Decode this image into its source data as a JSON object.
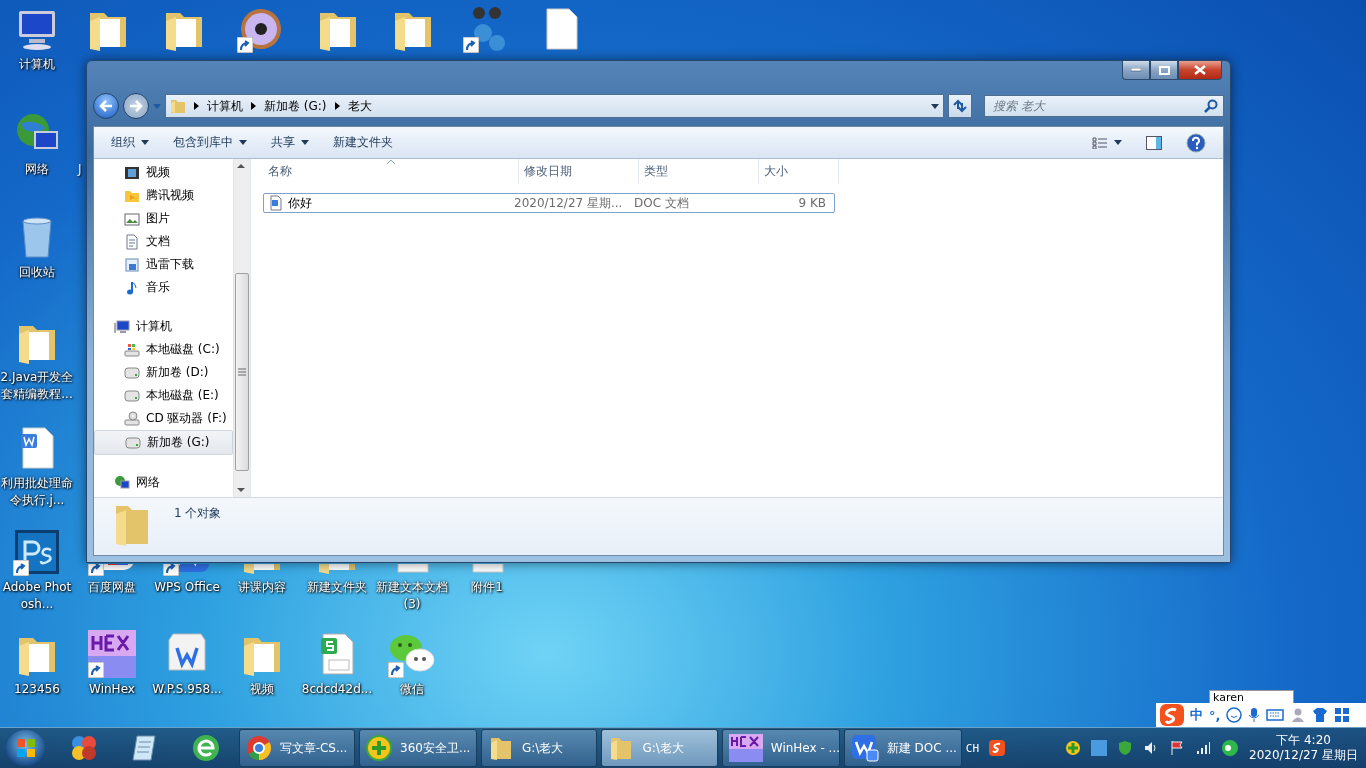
{
  "desktop": {
    "icons": [
      {
        "kind": "computer",
        "label": "计算机",
        "shortcut": false
      },
      {
        "kind": "folder",
        "shortcut": false
      },
      {
        "kind": "folder",
        "shortcut": false
      },
      {
        "kind": "disc",
        "shortcut": true
      },
      {
        "kind": "folder",
        "shortcut": false
      },
      {
        "kind": "folder",
        "shortcut": false
      },
      {
        "kind": "molecule",
        "shortcut": true
      },
      {
        "kind": "blank",
        "shortcut": false
      },
      {
        "kind": "globe",
        "label": "网络",
        "shortcut": false
      },
      {
        "kind": "bin",
        "label": "回收站",
        "shortcut": false
      },
      {
        "kind": "folder",
        "label": "2.Java开发全套精编教程...",
        "shortcut": false
      },
      {
        "kind": "worddoc",
        "label": "利用批处理命令执行.j...",
        "shortcut": false
      },
      {
        "kind": "ps",
        "label": "Adobe Photosh...",
        "shortcut": true
      },
      {
        "kind": "folder",
        "label": "123456",
        "shortcut": false
      },
      {
        "kind": "baidu",
        "label": "百度网盘",
        "shortcut": true
      },
      {
        "kind": "wps",
        "label": "WPS Office",
        "shortcut": true
      },
      {
        "kind": "folder",
        "label": "讲课内容",
        "shortcut": false
      },
      {
        "kind": "folder",
        "label": "新建文件夹",
        "shortcut": false
      },
      {
        "kind": "blank",
        "label": "新建文本文档 (3)",
        "shortcut": false
      },
      {
        "kind": "blank",
        "label": "附件1",
        "shortcut": false
      },
      {
        "kind": "hex",
        "label": "WinHex",
        "shortcut": true
      },
      {
        "kind": "wpsbox",
        "label": "W.P.S.958...",
        "shortcut": false
      },
      {
        "kind": "folder",
        "label": "视频",
        "shortcut": false
      },
      {
        "kind": "sheet",
        "label": "8cdcd42d...",
        "shortcut": false
      },
      {
        "kind": "wechat",
        "label": "微信",
        "shortcut": true
      }
    ],
    "fragment": "J"
  },
  "window": {
    "address": [
      "计算机",
      "新加卷 (G:)",
      "老大"
    ],
    "search": {
      "placeholder": "搜索 老大"
    },
    "toolbar": [
      {
        "label": "组织",
        "menu": true
      },
      {
        "label": "包含到库中",
        "menu": true
      },
      {
        "label": "共享",
        "menu": true
      },
      {
        "label": "新建文件夹",
        "menu": false
      }
    ],
    "nav": [
      {
        "kind": "video",
        "label": "视频",
        "selected": false
      },
      {
        "kind": "tencent",
        "label": "腾讯视频",
        "selected": false
      },
      {
        "kind": "pictures",
        "label": "图片",
        "selected": false
      },
      {
        "kind": "docs",
        "label": "文档",
        "selected": false
      },
      {
        "kind": "download",
        "label": "迅雷下载",
        "selected": false
      },
      {
        "kind": "music",
        "label": "音乐",
        "selected": false
      },
      {
        "kind": "computer",
        "label": "计算机",
        "selected": false,
        "children": [
          {
            "kind": "winDrive",
            "label": "本地磁盘 (C:)",
            "selected": false
          },
          {
            "kind": "drive",
            "label": "新加卷 (D:)",
            "selected": false
          },
          {
            "kind": "drive",
            "label": "本地磁盘 (E:)",
            "selected": false
          },
          {
            "kind": "cd",
            "label": "CD 驱动器 (F:)",
            "selected": false
          },
          {
            "kind": "drive",
            "label": "新加卷 (G:)",
            "selected": true
          }
        ]
      },
      {
        "kind": "network",
        "label": "网络",
        "selected": false
      }
    ],
    "columns": [
      {
        "label": "名称",
        "sorted": true
      },
      {
        "label": "修改日期",
        "sorted": false
      },
      {
        "label": "类型",
        "sorted": false
      },
      {
        "label": "大小",
        "sorted": false
      }
    ],
    "files": [
      {
        "name": "你好",
        "date": "2020/12/27 星期...",
        "type": "DOC 文档",
        "size": "9 KB",
        "selected": true
      }
    ],
    "status": "1 个对象"
  },
  "ime": {
    "tooltip": "karen",
    "mode": "中",
    "punctuation": "°,"
  },
  "taskbar": {
    "tasks": [
      {
        "kind": "chrome",
        "label": "写文章-CS...",
        "selected": false
      },
      {
        "kind": "plus360",
        "label": "360安全卫...",
        "selected": false
      },
      {
        "kind": "folder",
        "label": "G:\\老大",
        "selected": false
      },
      {
        "kind": "folder",
        "label": "G:\\老大",
        "selected": true
      },
      {
        "kind": "hex",
        "label": "WinHex - ...",
        "selected": false
      },
      {
        "kind": "wps",
        "label": "新建 DOC ...",
        "selected": false
      }
    ],
    "language": "CH",
    "time": "下午 4:20",
    "date": "2020/12/27 星期日"
  }
}
